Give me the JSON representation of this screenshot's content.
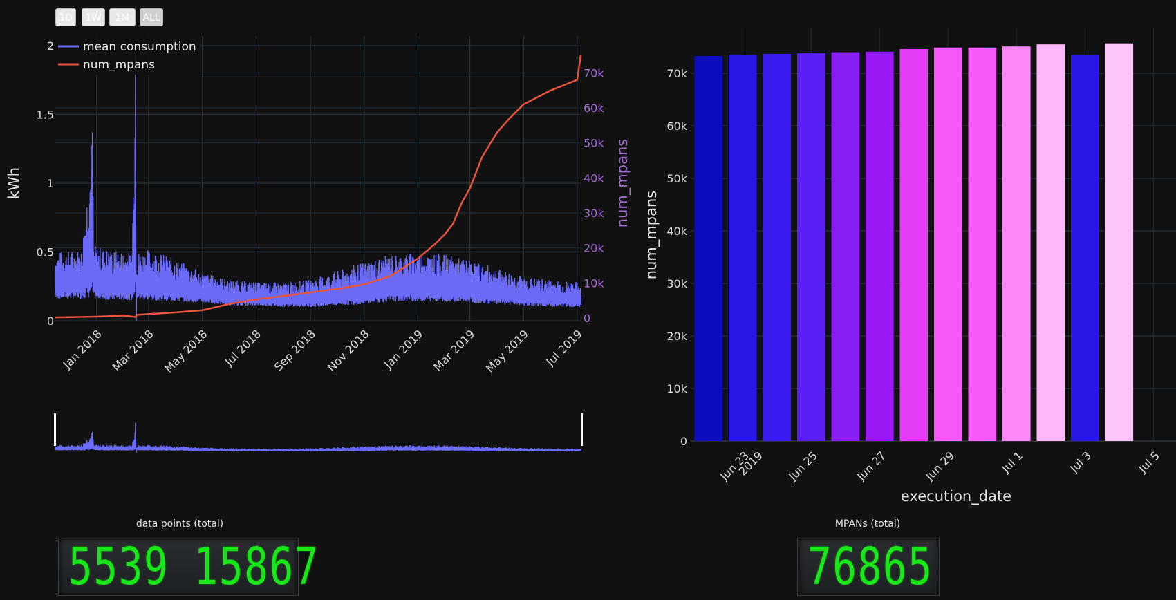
{
  "range_selector": {
    "buttons": [
      "1D",
      "1W",
      "1M",
      "ALL"
    ]
  },
  "line_chart": {
    "legend": {
      "series1": "mean consumption",
      "series2": "num_mpans"
    },
    "y_left_title": "kWh",
    "y_right_title": "num_mpans",
    "x_ticks": [
      "Jan 2018",
      "Mar 2018",
      "May 2018",
      "Jul 2018",
      "Sep 2018",
      "Nov 2018",
      "Jan 2019",
      "Mar 2019",
      "May 2019",
      "Jul 2019"
    ],
    "y_left_ticks": [
      "0",
      "0.5",
      "1",
      "1.5",
      "2"
    ],
    "y_right_ticks": [
      "0",
      "10k",
      "20k",
      "30k",
      "40k",
      "50k",
      "60k",
      "70k"
    ]
  },
  "bar_chart": {
    "x_title": "execution_date",
    "y_title": "num_mpans",
    "x_ticks": [
      "Jun 23\n2019",
      "Jun 25",
      "Jun 27",
      "Jun 29",
      "Jul 1",
      "Jul 3",
      "Jul 5"
    ],
    "y_ticks": [
      "0",
      "10k",
      "20k",
      "30k",
      "40k",
      "50k",
      "60k",
      "70k"
    ]
  },
  "counters": {
    "data_points": {
      "label": "data points (total)",
      "value": "5539 15867"
    },
    "mpans": {
      "label": "MPANs (total)",
      "value": "76865"
    }
  },
  "colors": {
    "consumption": "#6b6bf8",
    "mpans": "#e8553c",
    "digits": "#18e818",
    "background": "#111111"
  },
  "chart_data": [
    {
      "type": "line",
      "series": [
        {
          "name": "mean consumption",
          "x": [
            "2017-11-15",
            "2017-12-15",
            "2017-12-27",
            "2017-12-28",
            "2018-01-15",
            "2018-02-10",
            "2018-02-14",
            "2018-02-15",
            "2018-03-01",
            "2018-04-01",
            "2018-05-01",
            "2018-06-01",
            "2018-07-01",
            "2018-08-01",
            "2018-09-01",
            "2018-10-01",
            "2018-11-01",
            "2018-12-01",
            "2019-01-01",
            "2019-02-01",
            "2019-03-01",
            "2019-04-01",
            "2019-05-01",
            "2019-06-01",
            "2019-07-05"
          ],
          "low": [
            0.16,
            0.16,
            0.16,
            0.16,
            0.15,
            0.15,
            0.15,
            0.15,
            0.15,
            0.14,
            0.13,
            0.11,
            0.11,
            0.1,
            0.1,
            0.11,
            0.12,
            0.14,
            0.14,
            0.14,
            0.13,
            0.12,
            0.11,
            0.1,
            0.1
          ],
          "high": [
            0.5,
            0.52,
            1.37,
            0.55,
            0.52,
            0.5,
            1.97,
            0.5,
            0.52,
            0.45,
            0.35,
            0.3,
            0.28,
            0.28,
            0.3,
            0.36,
            0.43,
            0.48,
            0.5,
            0.48,
            0.44,
            0.38,
            0.32,
            0.3,
            0.28
          ]
        },
        {
          "name": "num_mpans",
          "x": [
            "2017-11-15",
            "2017-12-01",
            "2018-01-01",
            "2018-02-01",
            "2018-02-14",
            "2018-02-16",
            "2018-03-01",
            "2018-04-01",
            "2018-05-01",
            "2018-06-01",
            "2018-07-01",
            "2018-08-01",
            "2018-09-01",
            "2018-10-01",
            "2018-11-01",
            "2018-12-01",
            "2019-01-01",
            "2019-01-20",
            "2019-02-01",
            "2019-02-10",
            "2019-02-20",
            "2019-03-01",
            "2019-03-15",
            "2019-04-01",
            "2019-04-15",
            "2019-05-01",
            "2019-06-01",
            "2019-07-01",
            "2019-07-05"
          ],
          "values": [
            200,
            250,
            400,
            700,
            300,
            900,
            1100,
            1600,
            2200,
            4000,
            5300,
            6300,
            7300,
            8300,
            9600,
            12000,
            17000,
            21000,
            24000,
            27000,
            33000,
            37000,
            46000,
            53000,
            57000,
            61000,
            65000,
            68000,
            75000
          ]
        }
      ],
      "ylabel": "kWh",
      "ylim": [
        0,
        2.05
      ],
      "y2label": "num_mpans",
      "y2lim": [
        0,
        75000
      ],
      "grid": true,
      "legend": "top-left"
    },
    {
      "type": "bar",
      "categories": [
        "2019-06-22",
        "2019-06-23",
        "2019-06-24",
        "2019-06-25",
        "2019-06-26",
        "2019-06-27",
        "2019-06-28",
        "2019-06-29",
        "2019-06-30",
        "2019-07-01",
        "2019-07-02",
        "2019-07-03",
        "2019-07-04"
      ],
      "values": [
        73300,
        73500,
        73700,
        73800,
        74000,
        74100,
        74600,
        74900,
        74900,
        75100,
        75500,
        73500,
        75700
      ],
      "xlabel": "execution_date",
      "ylabel": "num_mpans",
      "ylim": [
        0,
        75000
      ],
      "colors": [
        "#0d0dc0",
        "#2a18e6",
        "#3a1bf0",
        "#5a1ff5",
        "#8a1ff5",
        "#9a1af5",
        "#e43cf5",
        "#f55af8",
        "#f55af8",
        "#fa88f8",
        "#fdb9f9",
        "#2a18e6",
        "#fdc4fa"
      ]
    }
  ]
}
